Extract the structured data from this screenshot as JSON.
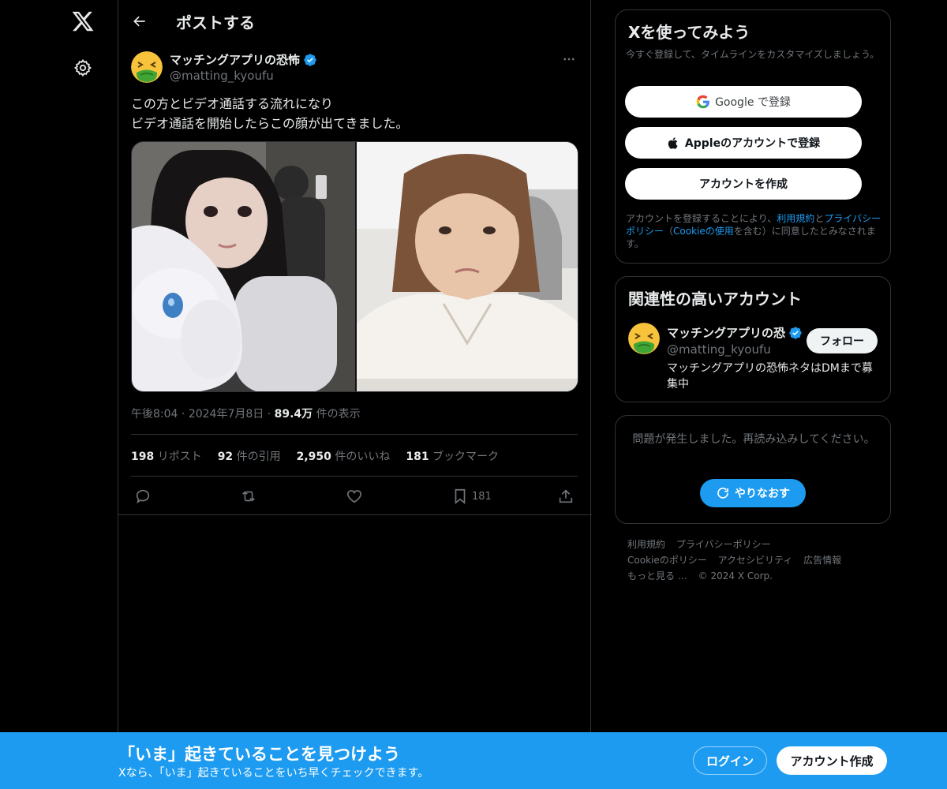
{
  "colors": {
    "background": "#000000",
    "accent": "#1d9bf0",
    "border": "#2f3336",
    "muted": "#71767b"
  },
  "header": {
    "title": "ポストする"
  },
  "post": {
    "author_name": "マッチングアプリの恐怖",
    "author_handle": "@matting_kyoufu",
    "text_line1": "この方とビデオ通話する流れになり",
    "text_line2": "ビデオ通話を開始したらこの顔が出てきました。",
    "time": "午後8:04",
    "date": "2024年7月8日",
    "views_count": "89.4万",
    "views_label": "件の表示",
    "stats": {
      "reposts_count": "198",
      "reposts_label": "リポスト",
      "quotes_count": "92",
      "quotes_label": "件の引用",
      "likes_count": "2,950",
      "likes_label": "件のいいね",
      "bookmarks_count": "181",
      "bookmarks_label": "ブックマーク"
    },
    "bookmark_action_count": "181"
  },
  "signup": {
    "title": "Xを使ってみよう",
    "subtitle": "今すぐ登録して、タイムラインをカスタマイズしましょう。",
    "google_label": "Google で登録",
    "apple_label": "Appleのアカウントで登録",
    "create_label": "アカウントを作成",
    "legal_prefix": "アカウントを登録することにより、",
    "legal_terms": "利用規約",
    "legal_and": "と",
    "legal_privacy": "プライバシーポリシー",
    "legal_paren_open": "（",
    "legal_cookie": "Cookieの使用",
    "legal_suffix": "を含む）に同意したとみなされます。"
  },
  "related": {
    "title": "関連性の高いアカウント",
    "name": "マッチングアプリの恐",
    "handle": "@matting_kyoufu",
    "follow_label": "フォロー",
    "bio": "マッチングアプリの恐怖ネタはDMまで募集中"
  },
  "error": {
    "message": "問題が発生しました。再読み込みしてください。",
    "retry_label": "やりなおす"
  },
  "footer": {
    "links": [
      "利用規約",
      "プライバシーポリシー",
      "Cookieのポリシー",
      "アクセシビリティ",
      "広告情報",
      "もっと見る …"
    ],
    "copyright": "© 2024 X Corp."
  },
  "banner": {
    "title": "「いま」起きていることを見つけよう",
    "subtitle": "Xなら、「いま」起きていることをいち早くチェックできます。",
    "login_label": "ログイン",
    "create_label": "アカウント作成"
  }
}
